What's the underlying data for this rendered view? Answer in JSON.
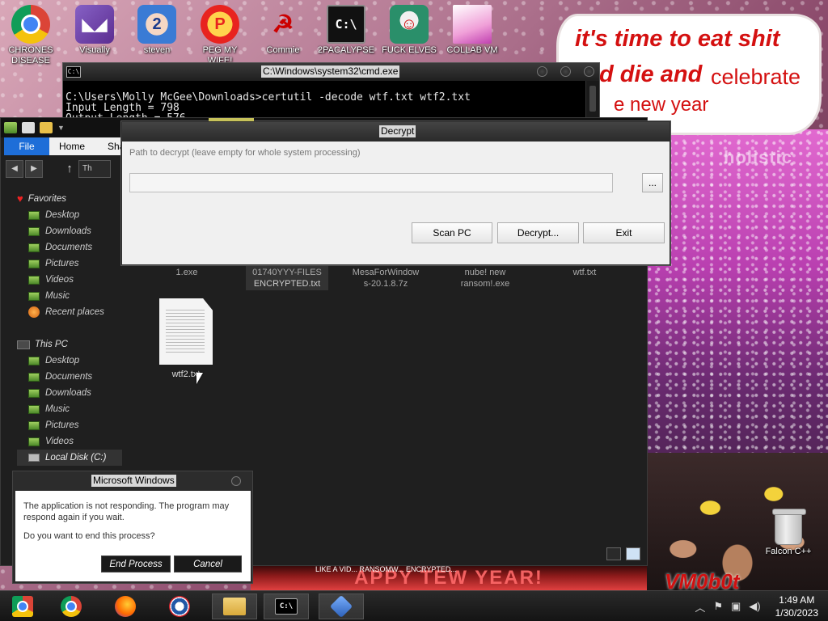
{
  "desktop": {
    "icons": [
      {
        "label": "CHRONES DISEASE",
        "icon": "chrome-icon"
      },
      {
        "label": "Visually",
        "icon": "visual-studio-icon"
      },
      {
        "label": "steven",
        "icon": "steven-icon"
      },
      {
        "label": "PEG MY WIFE!",
        "icon": "peg-icon"
      },
      {
        "label": "Commie",
        "icon": "commie-icon"
      },
      {
        "label": "2PACALYPSE",
        "icon": "cmd-icon"
      },
      {
        "label": "FUCK ELVES",
        "icon": "elves-icon"
      },
      {
        "label": "COLLAB VM",
        "icon": "collab-vm-icon"
      }
    ],
    "recycle_bin_label": "Falcon C++",
    "wallpaper_text": {
      "meme_line1": "it's time to eat shit",
      "meme_line2": "d die and",
      "meme_line2b": "celebrate",
      "meme_line3": "e new year",
      "holistic": "holistic",
      "banner": "APPY TEW YEAR!",
      "banner_small": "LIKE A VID...    RANSOMW...    ENCRYPTED...",
      "vm_tag": "VM0b0t"
    }
  },
  "cmd": {
    "title": "C:\\Windows\\system32\\cmd.exe",
    "icon_text": "C:\\",
    "line1": "C:\\Users\\Molly McGee\\Downloads>certutil -decode wtf.txt wtf2.txt",
    "line2": "Input Length = 798",
    "line3": "Output Length = 576"
  },
  "explorer": {
    "tabs": [
      "File",
      "Home",
      "Sha"
    ],
    "address_partial": "Th",
    "sidebar": {
      "favorites_label": "Favorites",
      "favorites": [
        "Desktop",
        "Downloads",
        "Documents",
        "Pictures",
        "Videos",
        "Music",
        "Recent places"
      ],
      "this_pc_label": "This PC",
      "this_pc": [
        "Desktop",
        "Documents",
        "Downloads",
        "Music",
        "Pictures",
        "Videos",
        "Local Disk (C:)"
      ]
    },
    "partial_files": [
      {
        "line1": "1.exe",
        "line2": ""
      },
      {
        "line1": "01740YYY-FILES",
        "line2": "ENCRYPTED.txt"
      },
      {
        "line1": "MesaForWindow",
        "line2": "s-20.1.8.7z"
      },
      {
        "line1": "nube! new",
        "line2": "ransom!.exe"
      },
      {
        "line1": "wtf.txt",
        "line2": ""
      }
    ],
    "visible_file": "wtf2.txt"
  },
  "decrypt_dialog": {
    "title": "Decrypt",
    "path_label": "Path to decrypt (leave empty for whole system processing)",
    "path_value": "",
    "browse_label": "...",
    "scan_label": "Scan PC",
    "decrypt_label": "Decrypt...",
    "exit_label": "Exit"
  },
  "not_responding": {
    "title": "Microsoft Windows",
    "message1": "The application is not responding. The program may respond again if you wait.",
    "message2": "Do you want to end this process?",
    "end_label": "End Process",
    "cancel_label": "Cancel"
  },
  "taskbar": {
    "cmd_icon_text": "C:\\",
    "time": "1:49 AM",
    "date": "1/30/2023"
  }
}
